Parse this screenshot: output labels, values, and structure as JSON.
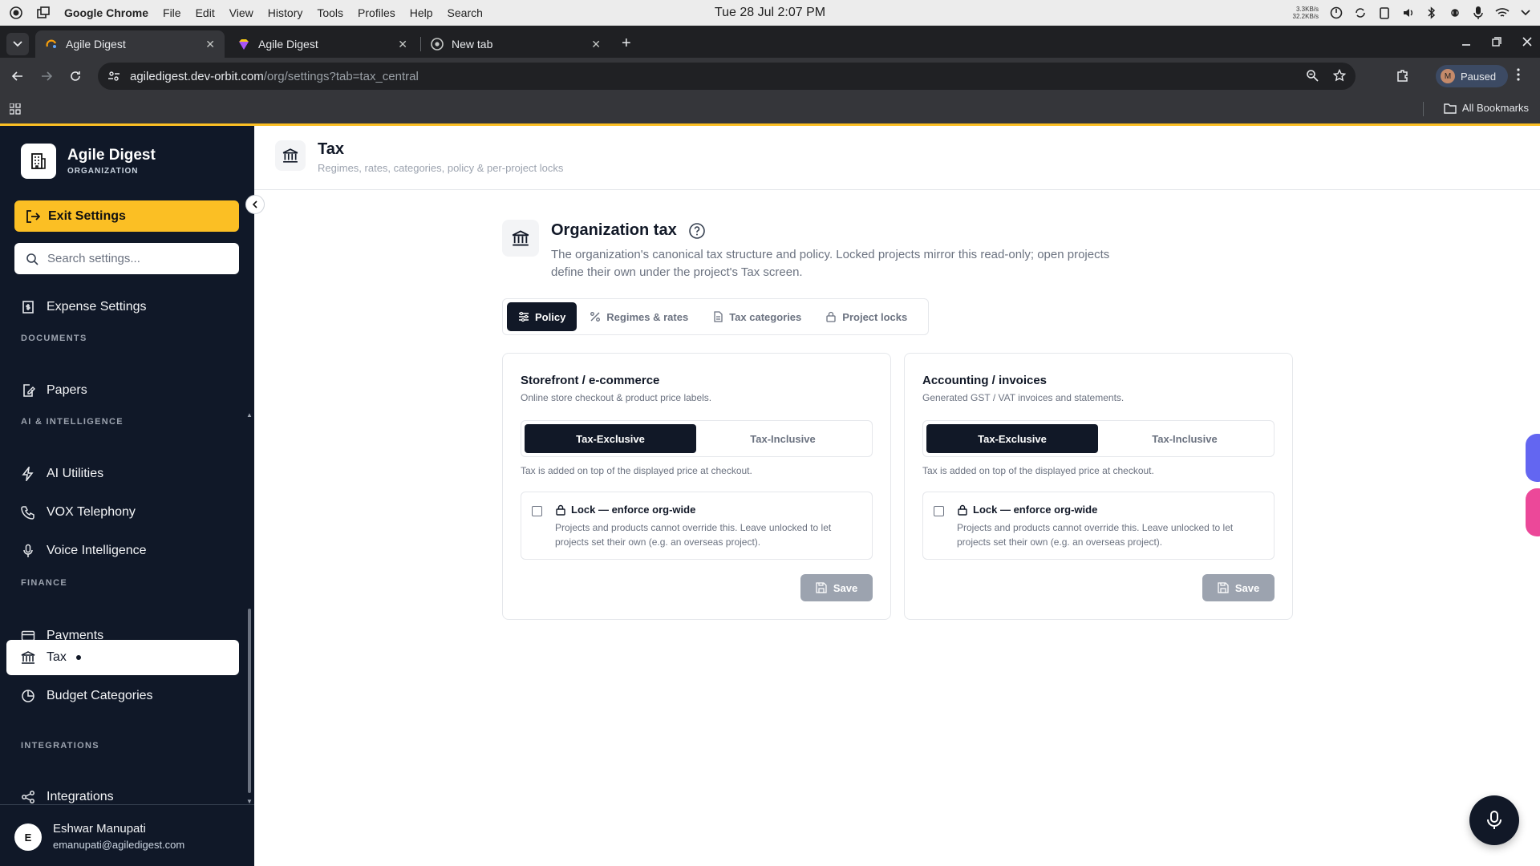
{
  "os": {
    "app_name": "Google Chrome",
    "menus": [
      "File",
      "Edit",
      "View",
      "History",
      "Tools",
      "Profiles",
      "Help",
      "Search"
    ],
    "clock": "Tue 28 Jul  2:07 PM",
    "net_up": "3.3KB/s",
    "net_down": "32.2KB/s"
  },
  "browser": {
    "tabs": [
      {
        "title": "Agile Digest",
        "active": true
      },
      {
        "title": "Agile Digest",
        "active": false
      },
      {
        "title": "New tab",
        "active": false
      }
    ],
    "url_host": "agiledigest.dev-orbit.com",
    "url_path": "/org/settings?tab=tax_central",
    "profile_initial": "M",
    "profile_status": "Paused",
    "all_bookmarks": "All Bookmarks"
  },
  "sidebar": {
    "brand": "Agile Digest",
    "brand_sub": "ORGANIZATION",
    "exit_label": "Exit Settings",
    "search_placeholder": "Search settings...",
    "items": [
      {
        "label": "Expense Settings"
      },
      {
        "heading": "DOCUMENTS"
      },
      {
        "label": "Papers"
      },
      {
        "heading": "AI & INTELLIGENCE"
      },
      {
        "label": "AI Utilities"
      },
      {
        "label": "VOX Telephony"
      },
      {
        "label": "Voice Intelligence"
      },
      {
        "heading": "FINANCE"
      },
      {
        "label": "Payments"
      },
      {
        "label": "Tax"
      },
      {
        "label": "Budget Categories"
      },
      {
        "heading": "INTEGRATIONS"
      },
      {
        "label": "Integrations"
      }
    ],
    "user": {
      "initial": "E",
      "name": "Eshwar Manupati",
      "email": "emanupati@agiledigest.com"
    }
  },
  "page": {
    "title": "Tax",
    "subtitle": "Regimes, rates, categories, policy & per-project locks",
    "section_title": "Organization tax",
    "section_desc": "The organization's canonical tax structure and policy. Locked projects mirror this read-only; open projects define their own under the project's Tax screen.",
    "tabs": [
      "Policy",
      "Regimes & rates",
      "Tax categories",
      "Project locks"
    ],
    "active_tab": "Policy"
  },
  "cards": [
    {
      "title": "Storefront / e-commerce",
      "subtitle": "Online store checkout & product price labels.",
      "opt_exclusive": "Tax-Exclusive",
      "opt_inclusive": "Tax-Inclusive",
      "selected": "Tax-Exclusive",
      "hint": "Tax is added on top of the displayed price at checkout.",
      "lock_title": "Lock — enforce org-wide",
      "lock_desc": "Projects and products cannot override this. Leave unlocked to let projects set their own (e.g. an overseas project).",
      "locked": false,
      "save_label": "Save"
    },
    {
      "title": "Accounting / invoices",
      "subtitle": "Generated GST / VAT invoices and statements.",
      "opt_exclusive": "Tax-Exclusive",
      "opt_inclusive": "Tax-Inclusive",
      "selected": "Tax-Exclusive",
      "hint": "Tax is added on top of the displayed price at checkout.",
      "lock_title": "Lock — enforce org-wide",
      "lock_desc": "Projects and products cannot override this. Leave unlocked to let projects set their own (e.g. an overseas project).",
      "locked": false,
      "save_label": "Save"
    }
  ],
  "colors": {
    "sidebar_bg": "#101828",
    "accent": "#fbbf24",
    "active_dark": "#111827"
  }
}
